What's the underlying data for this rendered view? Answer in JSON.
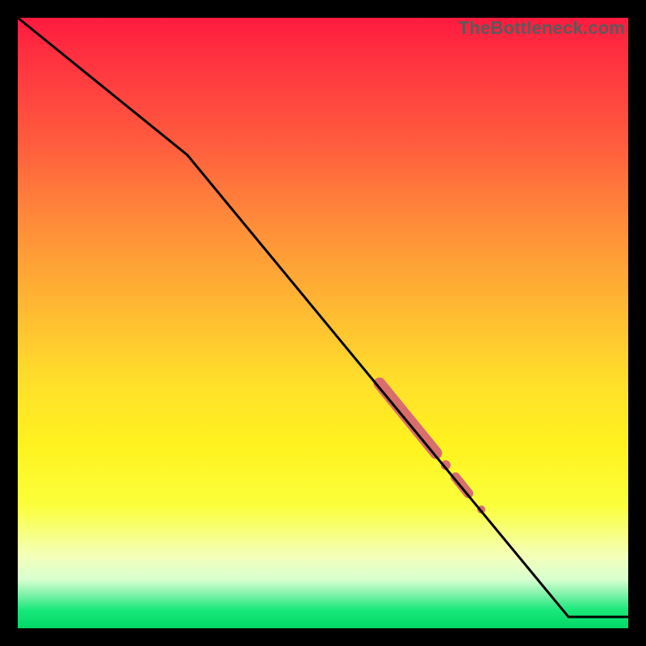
{
  "watermark": "TheBottleneck.com",
  "chart_data": {
    "type": "line",
    "title": "",
    "xlabel": "",
    "ylabel": "",
    "xlim": [
      0,
      100
    ],
    "ylim": [
      0,
      100
    ],
    "grid": false,
    "legend": false,
    "series": [
      {
        "name": "curve",
        "color": "#000000",
        "x": [
          0,
          28,
          90,
          100
        ],
        "y": [
          100,
          78,
          2,
          2
        ]
      },
      {
        "name": "highlight-band",
        "color": "#d96d6d",
        "x": [
          59,
          60,
          61,
          62,
          63,
          64,
          65,
          66,
          67,
          68,
          70,
          72,
          73,
          75
        ],
        "y": [
          40,
          39,
          38,
          36,
          35,
          34,
          33,
          31,
          30,
          29,
          27,
          24,
          23,
          20
        ]
      }
    ],
    "background_gradient": {
      "top": "#ff1a3f",
      "mid": "#fff21f",
      "bottom": "#00d966"
    }
  }
}
